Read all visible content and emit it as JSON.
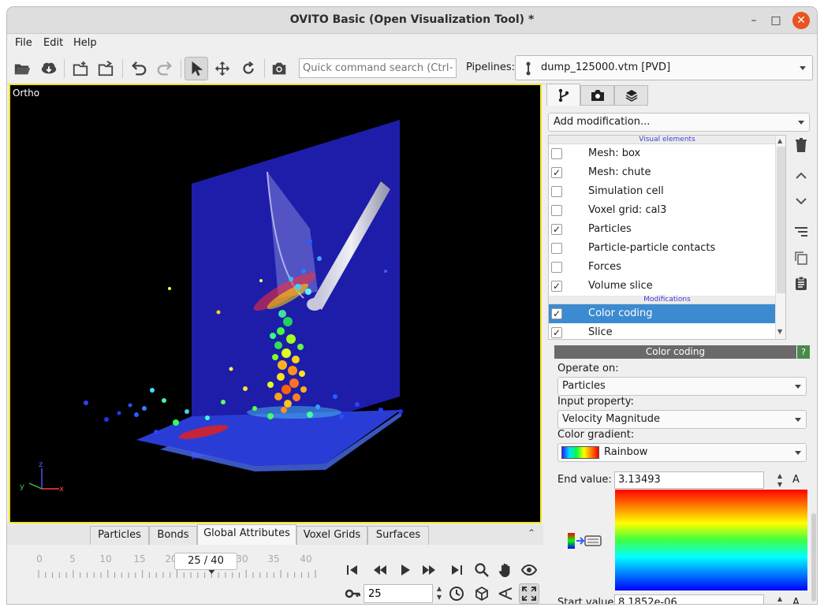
{
  "window": {
    "title": "OVITO Basic (Open Visualization Tool) *",
    "min": "–",
    "max": "□",
    "close": "✕"
  },
  "menu": {
    "file": "File",
    "edit": "Edit",
    "help": "Help"
  },
  "toolbar": {
    "search_placeholder": "Quick command search (Ctrl+Q)",
    "pipelines_label": "Pipelines:",
    "pipeline_value": "dump_125000.vtm [PVD]"
  },
  "viewport": {
    "label": "Ortho",
    "axes": {
      "x": "x",
      "y": "y",
      "z": "z"
    }
  },
  "bottom_tabs": [
    "Particles",
    "Bonds",
    "Global Attributes",
    "Voxel Grids",
    "Surfaces"
  ],
  "bottom_tabs_active": "Global Attributes",
  "animation": {
    "ruler_labels": [
      "0",
      "5",
      "10",
      "15",
      "20",
      "25",
      "30",
      "35",
      "40"
    ],
    "frame_display": "25 / 40",
    "frame_value": "25",
    "current_frame": 25,
    "total_frames": 40
  },
  "panel": {
    "add_modification": "Add modification...",
    "group_visual": "Visual elements",
    "group_modifications": "Modifications",
    "visual_elements": [
      {
        "label": "Mesh: box",
        "checked": false
      },
      {
        "label": "Mesh: chute",
        "checked": true
      },
      {
        "label": "Simulation cell",
        "checked": false
      },
      {
        "label": "Voxel grid: cal3",
        "checked": false
      },
      {
        "label": "Particles",
        "checked": true
      },
      {
        "label": "Particle-particle contacts",
        "checked": false
      },
      {
        "label": "Forces",
        "checked": false
      },
      {
        "label": "Volume slice",
        "checked": true
      }
    ],
    "modifications": [
      {
        "label": "Color coding",
        "checked": true,
        "selected": true
      },
      {
        "label": "Slice",
        "checked": true,
        "selected": false
      }
    ],
    "check_mark": "✓"
  },
  "color_coding": {
    "header": "Color coding",
    "help": "?",
    "operate_on_label": "Operate on:",
    "operate_on_value": "Particles",
    "input_property_label": "Input property:",
    "input_property_value": "Velocity Magnitude",
    "color_gradient_label": "Color gradient:",
    "color_gradient_value": "Rainbow",
    "end_value_label": "End value:",
    "end_value": "3.13493",
    "start_value_label": "Start value:",
    "start_value": "8.1852e-06",
    "unit": "A"
  }
}
